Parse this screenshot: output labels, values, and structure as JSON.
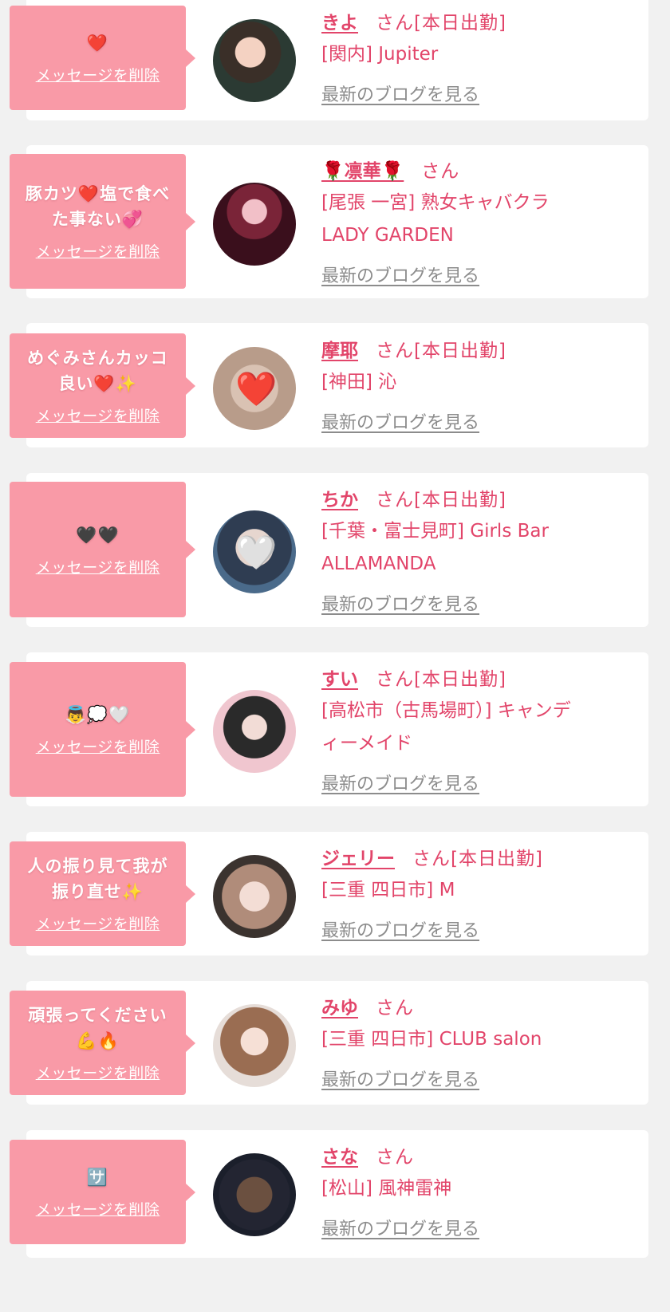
{
  "honorific": "さん",
  "delete_label": "メッセージを削除",
  "blog_label": "最新のブログを見る",
  "colors": {
    "page_background": "#f1f1f1",
    "card_background": "#ffffff",
    "bubble_pink": "#f99aa7",
    "name_pink": "#e2456a",
    "blog_link_gray": "#8c8c8c"
  },
  "entries": [
    {
      "message": "❤️",
      "name": "きよ",
      "attendance": "[本日出勤]",
      "shop": "[関内] Jupiter",
      "avatar_icon": "girl-photo-icon"
    },
    {
      "message": "豚カツ❤️塩で食べ\nた事ない💞",
      "name": "🌹凛華🌹",
      "attendance": "",
      "shop": "[尾張 一宮] 熟女キャバクラ\nLADY GARDEN",
      "avatar_icon": "kimono-photo-icon"
    },
    {
      "message": "めぐみさんカッコ\n良い❤️✨",
      "name": "摩耶",
      "attendance": "[本日出勤]",
      "shop": "[神田] 沁",
      "avatar_icon": "heart-face-photo-icon"
    },
    {
      "message": "🖤🖤",
      "name": "ちか",
      "attendance": "[本日出勤]",
      "shop": "[千葉・富士見町] Girls Bar\nALLAMANDA",
      "avatar_icon": "heart-face-photo-icon"
    },
    {
      "message": "👼💭🤍",
      "name": "すい",
      "attendance": "[本日出勤]",
      "shop": "[高松市（古馬場町）] キャンデ\nィーメイド",
      "avatar_icon": "cat-ears-photo-icon"
    },
    {
      "message": "人の振り見て我が\n振り直せ✨",
      "name": "ジェリー",
      "attendance": "[本日出勤]",
      "shop": "[三重 四日市] M",
      "avatar_icon": "headphones-photo-icon"
    },
    {
      "message": "頑張ってください\n💪🔥",
      "name": "みゆ",
      "attendance": "",
      "shop": "[三重 四日市] CLUB salon",
      "avatar_icon": "girl-photo-icon"
    },
    {
      "message": "🈂️",
      "name": "さな",
      "attendance": "",
      "shop": "[松山] 風神雷神",
      "avatar_icon": "dog-filter-photo-icon"
    }
  ]
}
